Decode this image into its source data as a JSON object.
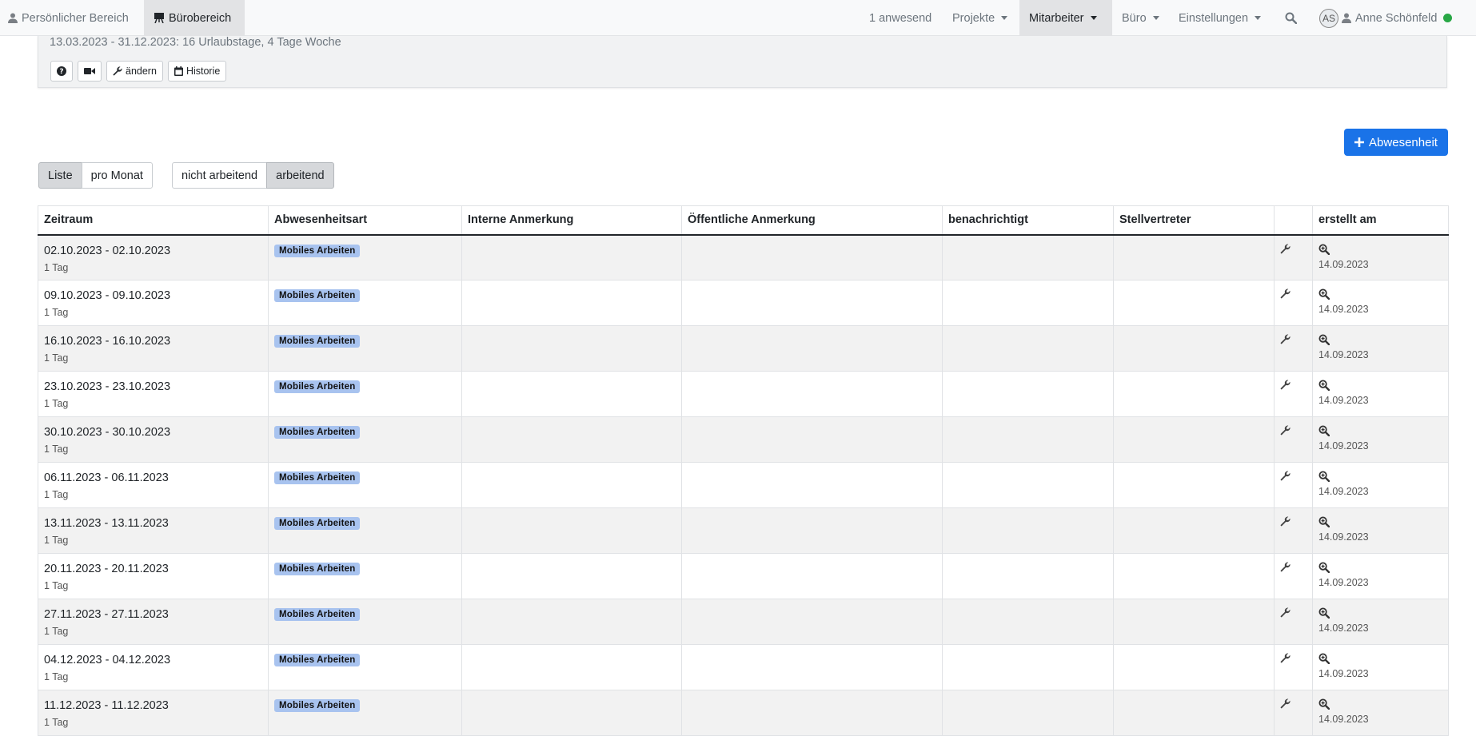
{
  "nav": {
    "personal": "Persönlicher Bereich",
    "office_area": "Bürobereich",
    "present": "1 anwesend",
    "projects": "Projekte",
    "employees": "Mitarbeiter",
    "office": "Büro",
    "settings": "Einstellungen",
    "avatar_initials": "AS",
    "user_name": "Anne Schönfeld",
    "status_color": "#28a745"
  },
  "card": {
    "info": "13.03.2023 - 31.12.2023: 16 Urlaubstage, 4 Tage Woche",
    "edit_label": "ändern",
    "history_label": "Historie"
  },
  "actions": {
    "add_absence": "Abwesenheit"
  },
  "view_toggle": {
    "list": "Liste",
    "per_month": "pro Monat"
  },
  "work_toggle": {
    "not_working": "nicht arbeitend",
    "working": "arbeitend"
  },
  "table": {
    "headers": {
      "period": "Zeitraum",
      "type": "Abwesenheitsart",
      "internal_note": "Interne Anmerkung",
      "public_note": "Öffentliche Anmerkung",
      "notified": "benachrichtigt",
      "substitute": "Stellvertreter",
      "actions": "",
      "created": "erstellt am"
    },
    "rows": [
      {
        "range": "02.10.2023 - 02.10.2023",
        "duration": "1 Tag",
        "type": "Mobiles Arbeiten",
        "created": "14.09.2023"
      },
      {
        "range": "09.10.2023 - 09.10.2023",
        "duration": "1 Tag",
        "type": "Mobiles Arbeiten",
        "created": "14.09.2023"
      },
      {
        "range": "16.10.2023 - 16.10.2023",
        "duration": "1 Tag",
        "type": "Mobiles Arbeiten",
        "created": "14.09.2023"
      },
      {
        "range": "23.10.2023 - 23.10.2023",
        "duration": "1 Tag",
        "type": "Mobiles Arbeiten",
        "created": "14.09.2023"
      },
      {
        "range": "30.10.2023 - 30.10.2023",
        "duration": "1 Tag",
        "type": "Mobiles Arbeiten",
        "created": "14.09.2023"
      },
      {
        "range": "06.11.2023 - 06.11.2023",
        "duration": "1 Tag",
        "type": "Mobiles Arbeiten",
        "created": "14.09.2023"
      },
      {
        "range": "13.11.2023 - 13.11.2023",
        "duration": "1 Tag",
        "type": "Mobiles Arbeiten",
        "created": "14.09.2023"
      },
      {
        "range": "20.11.2023 - 20.11.2023",
        "duration": "1 Tag",
        "type": "Mobiles Arbeiten",
        "created": "14.09.2023"
      },
      {
        "range": "27.11.2023 - 27.11.2023",
        "duration": "1 Tag",
        "type": "Mobiles Arbeiten",
        "created": "14.09.2023"
      },
      {
        "range": "04.12.2023 - 04.12.2023",
        "duration": "1 Tag",
        "type": "Mobiles Arbeiten",
        "created": "14.09.2023"
      },
      {
        "range": "11.12.2023 - 11.12.2023",
        "duration": "1 Tag",
        "type": "Mobiles Arbeiten",
        "created": "14.09.2023"
      }
    ]
  }
}
